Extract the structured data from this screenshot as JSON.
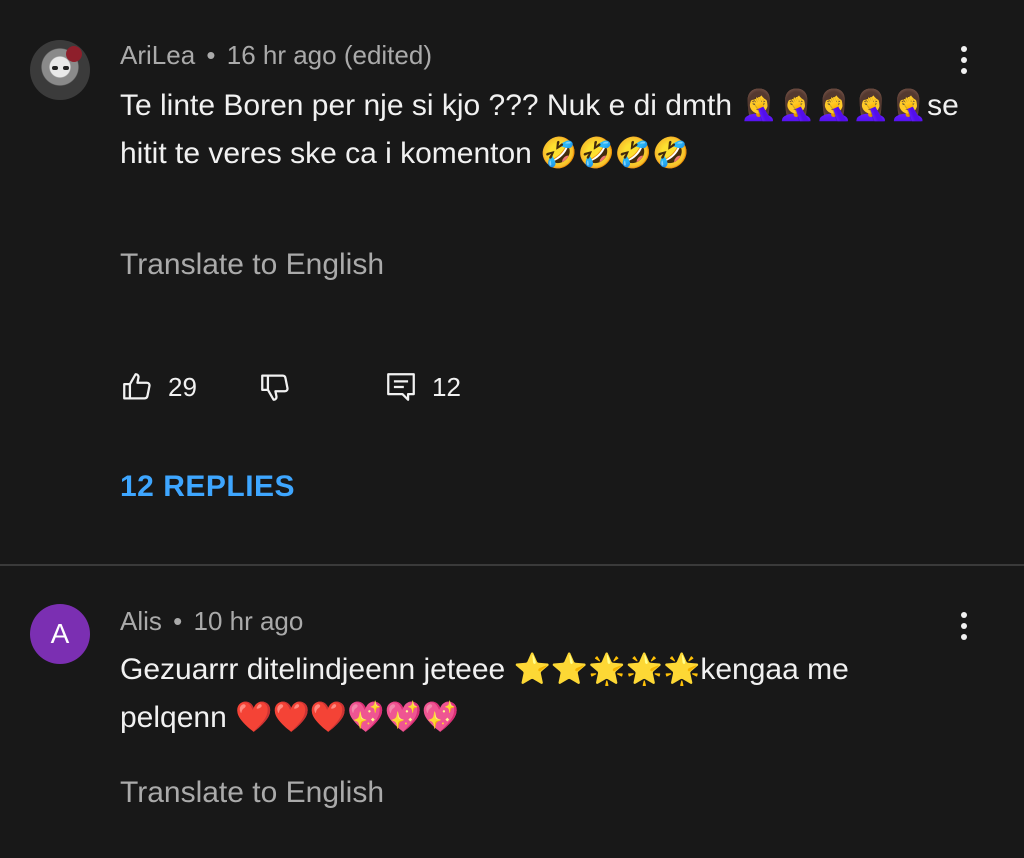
{
  "colors": {
    "background": "#181818",
    "text": "#f1f1f1",
    "muted": "#aaaaaa",
    "link": "#3ea6ff",
    "avatar_letter_bg": "#7b2fb2"
  },
  "comments": [
    {
      "author": "AriLea",
      "separator": "•",
      "time": "16 hr ago (edited)",
      "text": "Te linte Boren per nje si kjo ??? Nuk e di dmth 🤦‍♀️🤦‍♀️🤦‍♀️🤦‍♀️🤦‍♀️se hitit te veres ske ca i komenton 🤣🤣🤣🤣",
      "translate": "Translate to English",
      "likes": "29",
      "reply_count": "12",
      "replies_label": "12 REPLIES",
      "avatar_icon": "profile-photo"
    },
    {
      "author": "Alis",
      "separator": "•",
      "time": "10 hr ago",
      "text": "Gezuarrr ditelindjeenn jeteee ⭐⭐🌟🌟🌟kengaa me pelqenn ❤️❤️❤️💖💖💖",
      "translate": "Translate to English",
      "avatar_letter": "A"
    }
  ]
}
